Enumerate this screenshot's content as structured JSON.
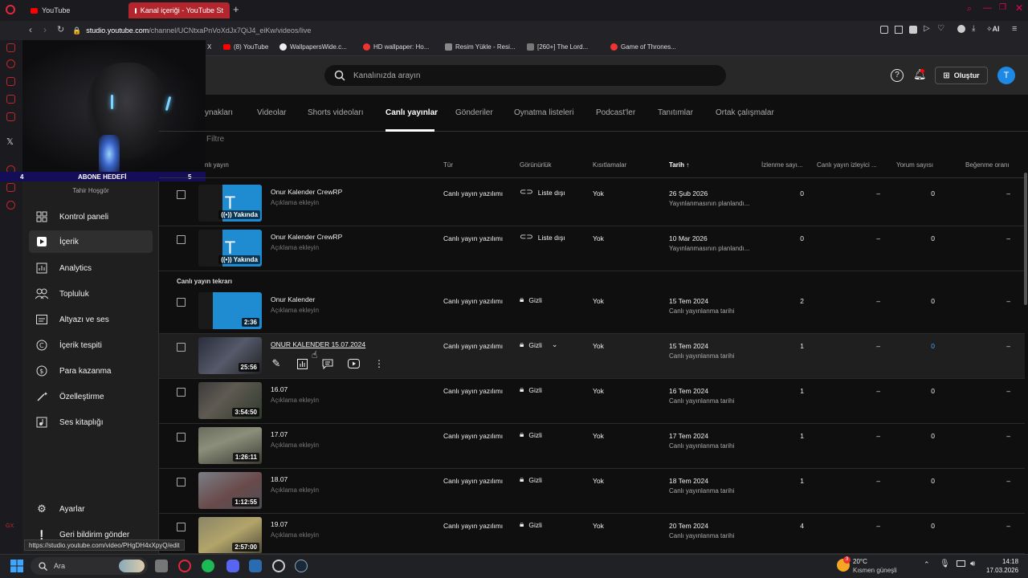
{
  "browser": {
    "tabs": [
      {
        "label": "YouTube",
        "active": false
      },
      {
        "label": "Kanal içeriği - YouTube St",
        "active": true
      }
    ],
    "url_prefix": "studio.youtube.com",
    "url_rest": "/channel/UCNtxaPnVoXdJx7QiJ4_eiKw/videos/live",
    "bookmarks": [
      "X",
      "(8) YouTube",
      "WallpapersWide.c...",
      "HD wallpaper: Ho...",
      "Resim Yükle - Resi...",
      "[260+] The Lord...",
      "Game of Thrones..."
    ],
    "ai_label": "AI"
  },
  "stream_overlay": {
    "goal_current": "4",
    "goal_label": "ABONE HEDEFİ",
    "goal_target": "5"
  },
  "header": {
    "search_placeholder": "Kanalınızda arayın",
    "create_label": "Oluştur",
    "avatar_letter": "T"
  },
  "sidebar": {
    "channel_name": "Tahir Hoşgör",
    "items": [
      {
        "label": "Kontrol paneli"
      },
      {
        "label": "İçerik"
      },
      {
        "label": "Analytics"
      },
      {
        "label": "Topluluk"
      },
      {
        "label": "Altyazı ve ses"
      },
      {
        "label": "İçerik tespiti"
      },
      {
        "label": "Para kazanma"
      },
      {
        "label": "Özelleştirme"
      },
      {
        "label": "Ses kitaplığı"
      }
    ],
    "settings_label": "Ayarlar",
    "feedback_label": "Geri bildirim gönder"
  },
  "content_tabs": [
    "ynakları",
    "Videolar",
    "Shorts videoları",
    "Canlı yayınlar",
    "Gönderiler",
    "Oynatma listeleri",
    "Podcast'ler",
    "Tanıtımlar",
    "Ortak çalışmalar"
  ],
  "filter_label": "Filtre",
  "columns": {
    "video": "nlı yayın",
    "type": "Tür",
    "visibility": "Görünürlük",
    "restrictions": "Kısıtlamalar",
    "date": "Tarih",
    "views": "İzlenme sayı...",
    "live_viewers": "Canlı yayın izleyici ...",
    "comments": "Yorum sayısı",
    "likes": "Beğenme oranı"
  },
  "section_label": "Canlı yayın tekrarı",
  "rows": [
    {
      "title": "Onur Kalender CrewRP",
      "desc": "Açıklama ekleyin",
      "badge": "Yakında",
      "type": "Canlı yayın yazılımı",
      "visibility": "Liste dışı",
      "restriction": "Yok",
      "date": "26 Şub 2026",
      "date_sub": "Yayınlanmasının planlandı...",
      "views": "0",
      "viewers": "–",
      "comments": "0",
      "likes": "–"
    },
    {
      "title": "Onur Kalender CrewRP",
      "desc": "Açıklama ekleyin",
      "badge": "Yakında",
      "type": "Canlı yayın yazılımı",
      "visibility": "Liste dışı",
      "restriction": "Yok",
      "date": "10 Mar 2026",
      "date_sub": "Yayınlanmasının planlandı...",
      "views": "0",
      "viewers": "–",
      "comments": "0",
      "likes": "–"
    },
    {
      "title": "Onur Kalender",
      "desc": "Açıklama ekleyin",
      "duration": "2:36",
      "type": "Canlı yayın yazılımı",
      "visibility": "Gizli",
      "restriction": "Yok",
      "date": "15 Tem 2024",
      "date_sub": "Canlı yayınlanma tarihi",
      "views": "2",
      "viewers": "–",
      "comments": "0",
      "likes": "–"
    },
    {
      "title": "ONUR KALENDER 15.07.2024",
      "desc": "",
      "duration": "25:56",
      "type": "Canlı yayın yazılımı",
      "visibility": "Gizli",
      "restriction": "Yok",
      "date": "15 Tem 2024",
      "date_sub": "Canlı yayınlanma tarihi",
      "views": "1",
      "viewers": "–",
      "comments": "0",
      "likes": "–"
    },
    {
      "title": "16.07",
      "desc": "Açıklama ekleyin",
      "duration": "3:54:50",
      "type": "Canlı yayın yazılımı",
      "visibility": "Gizli",
      "restriction": "Yok",
      "date": "16 Tem 2024",
      "date_sub": "Canlı yayınlanma tarihi",
      "views": "1",
      "viewers": "–",
      "comments": "0",
      "likes": "–"
    },
    {
      "title": "17.07",
      "desc": "Açıklama ekleyin",
      "duration": "1:26:11",
      "type": "Canlı yayın yazılımı",
      "visibility": "Gizli",
      "restriction": "Yok",
      "date": "17 Tem 2024",
      "date_sub": "Canlı yayınlanma tarihi",
      "views": "1",
      "viewers": "–",
      "comments": "0",
      "likes": "–"
    },
    {
      "title": "18.07",
      "desc": "Açıklama ekleyin",
      "duration": "1:12:55",
      "type": "Canlı yayın yazılımı",
      "visibility": "Gizli",
      "restriction": "Yok",
      "date": "18 Tem 2024",
      "date_sub": "Canlı yayınlanma tarihi",
      "views": "1",
      "viewers": "–",
      "comments": "0",
      "likes": "–"
    },
    {
      "title": "19.07",
      "desc": "Açıklama ekleyin",
      "duration": "2:57:00",
      "type": "Canlı yayın yazılımı",
      "visibility": "Gizli",
      "restriction": "Yok",
      "date": "20 Tem 2024",
      "date_sub": "Canlı yayınlanma tarihi",
      "views": "4",
      "viewers": "–",
      "comments": "0",
      "likes": "–"
    }
  ],
  "status_url": "https://studio.youtube.com/video/PHgDH4xXpyQ/edit",
  "taskbar": {
    "search_label": "Ara",
    "weather_temp": "20°C",
    "weather_desc": "Kısmen güneşli",
    "weather_badge": "3",
    "time": "14:18",
    "date": "17.03.2026"
  },
  "colors": {
    "accent": "#3ea6ff",
    "brand_red": "#ff0000",
    "opera_red": "#c2262e"
  }
}
